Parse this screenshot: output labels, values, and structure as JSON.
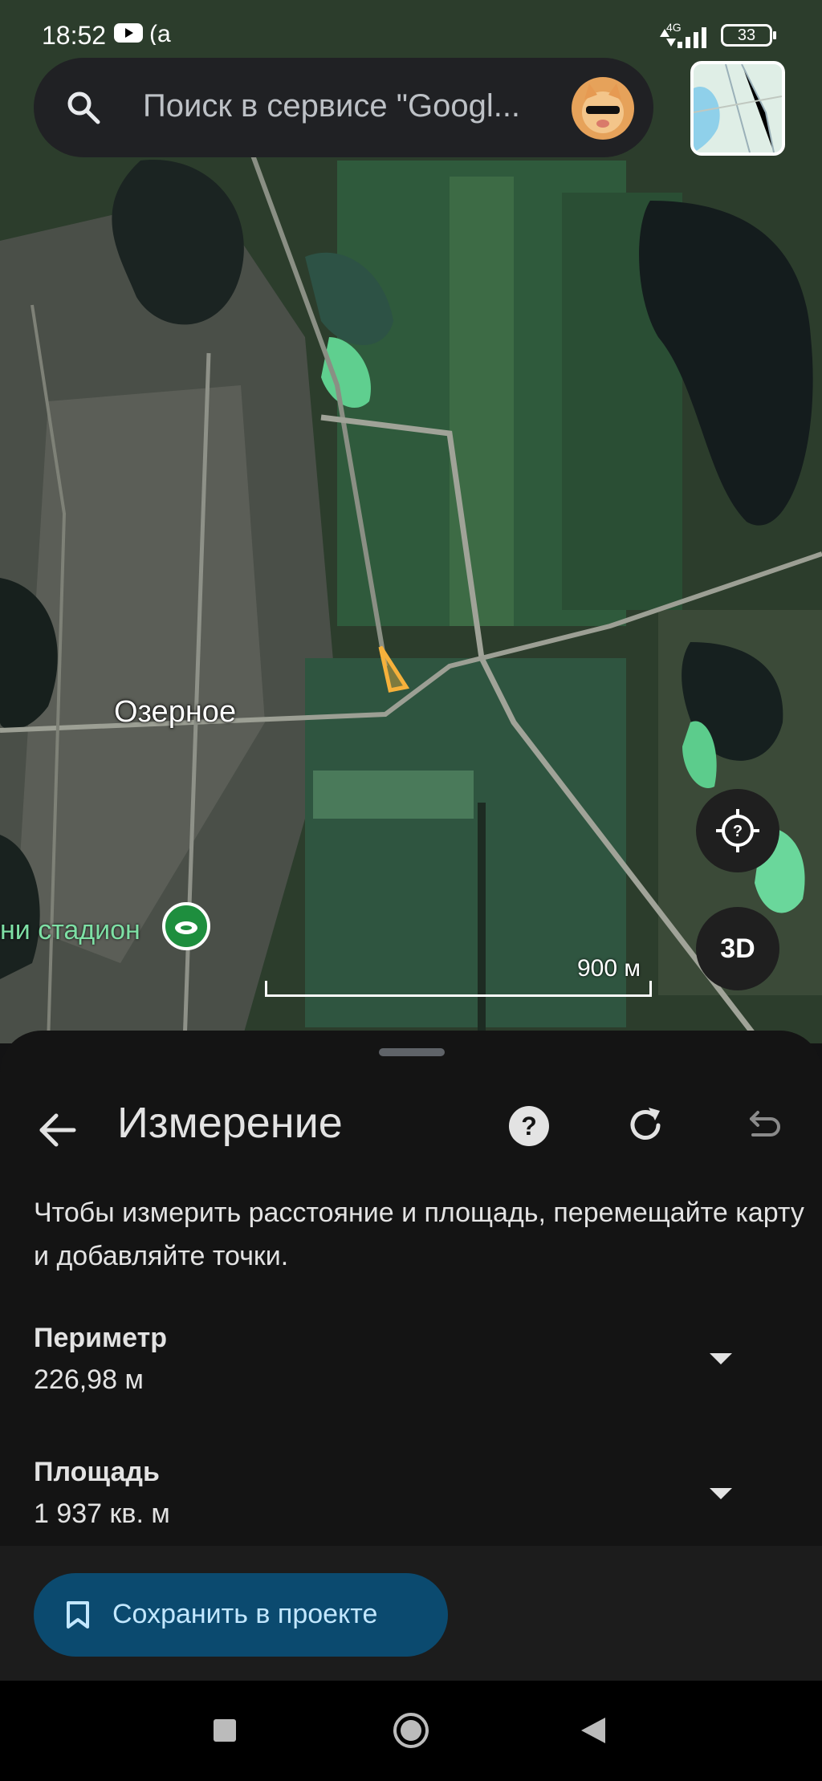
{
  "status_bar": {
    "time": "18:52",
    "network": "4G",
    "battery": "33",
    "icons": [
      "youtube-icon",
      "app-icon",
      "signal-icon",
      "battery-icon"
    ]
  },
  "search": {
    "placeholder": "Поиск в сервисе \"Googl...",
    "icon": "search-icon"
  },
  "map": {
    "place_label": "Озерное",
    "poi_label": "ни стадион",
    "scale_label": "900 м",
    "fab_3d_label": "3D",
    "fab_help_icon": "question-target-icon"
  },
  "sheet": {
    "title": "Измерение",
    "hint": "Чтобы измерить расстояние и площадь, перемещайте карту и добавляйте точки.",
    "measurements": [
      {
        "label": "Периметр",
        "value": "226,98 м"
      },
      {
        "label": "Площадь",
        "value": "1 937 кв. м"
      }
    ],
    "save_label": "Сохранить в проекте"
  },
  "colors": {
    "sheet_bg": "#141414",
    "save_button_bg": "#0b4a6f",
    "save_button_text": "#c2e7ff",
    "measure_triangle": "#f6b13b",
    "poi_green": "#1e8e3e"
  }
}
